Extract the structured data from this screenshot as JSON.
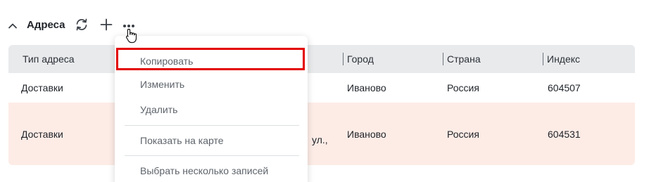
{
  "section": {
    "title": "Адреса"
  },
  "table": {
    "headers": [
      "Тип адреса",
      "Город",
      "Страна",
      "Индекс"
    ],
    "rows": [
      {
        "type": "Доставки",
        "address_fragment": "",
        "city": "Иваново",
        "country": "Россия",
        "index": "604507"
      },
      {
        "type": "Доставки",
        "address_fragment": "ул.,",
        "city": "Иваново",
        "country": "Россия",
        "index": "604531"
      }
    ]
  },
  "menu": {
    "items": [
      "Копировать",
      "Изменить",
      "Удалить",
      "Показать на карте",
      "Выбрать несколько записей"
    ]
  },
  "colors": {
    "highlight_border": "#e30000",
    "selected_row_bg": "#fdece6",
    "header_bg": "#e8eaec"
  },
  "icons": [
    "chevron-up-icon",
    "refresh-icon",
    "plus-icon",
    "more-horizontal-icon",
    "hand-pointer-icon"
  ]
}
